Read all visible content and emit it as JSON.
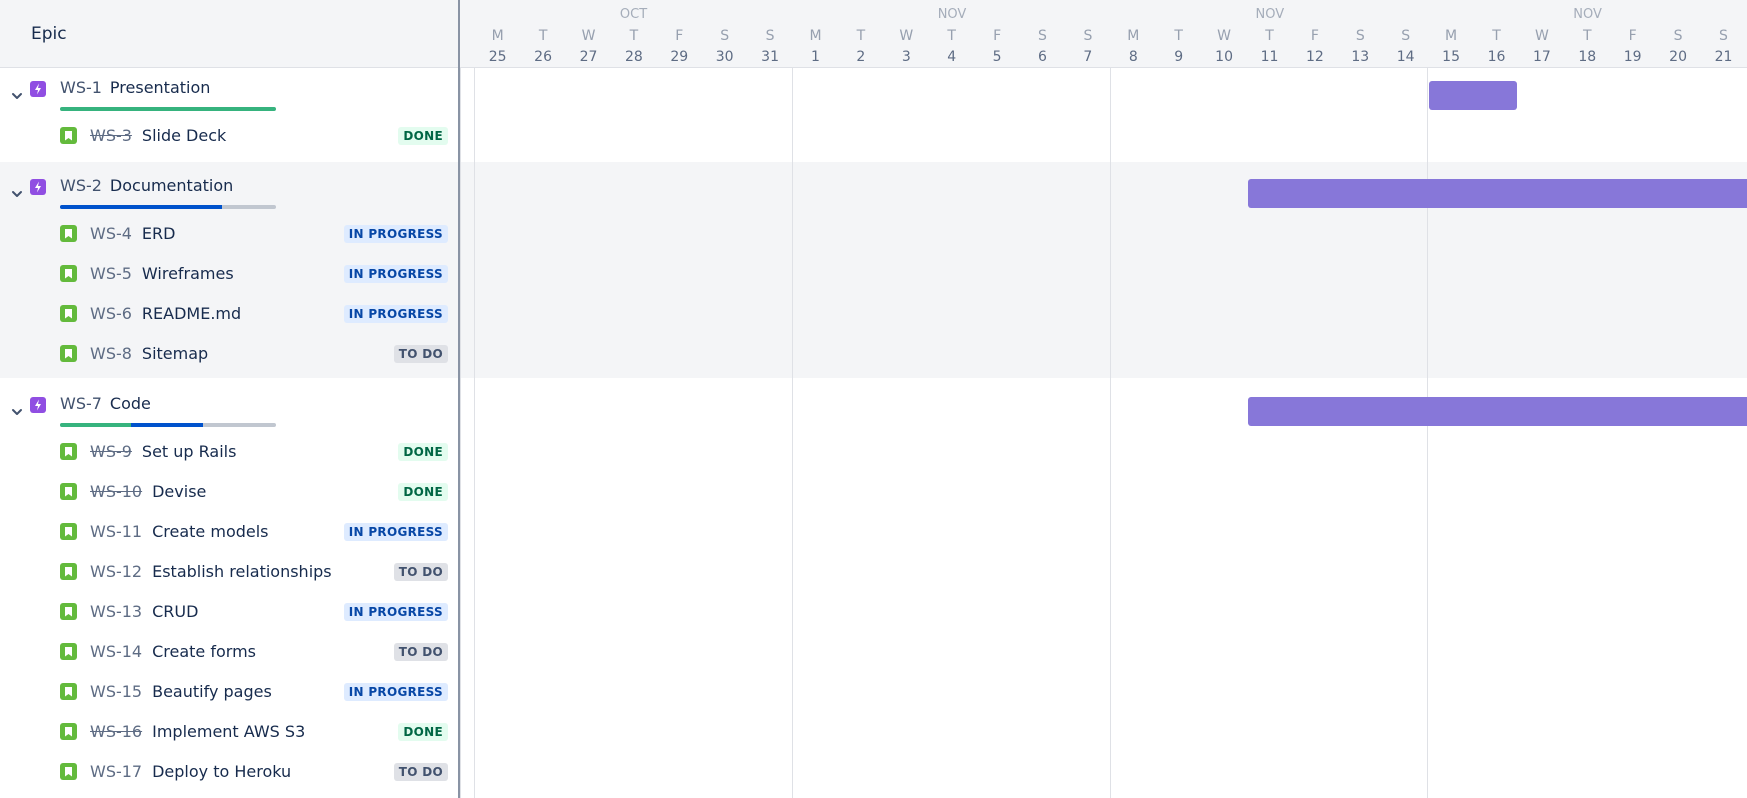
{
  "header": {
    "epic_column_title": "Epic"
  },
  "colors": {
    "epic_icon": "#904ee2",
    "story_icon": "#63ba3c",
    "bar": "#8777d9",
    "done": "#36b37e",
    "in_progress": "#0052cc",
    "remaining": "#c1c7d0"
  },
  "icons": {
    "collapse": "chevron-down-icon",
    "epic": "lightning-icon",
    "story": "bookmark-icon"
  },
  "epics": [
    {
      "key": "WS-1",
      "name": "Presentation",
      "progress": {
        "done": 1.0,
        "in_progress": 0.0
      },
      "issues": [
        {
          "key": "WS-3",
          "name": "Slide Deck",
          "status": "DONE"
        }
      ]
    },
    {
      "key": "WS-2",
      "name": "Documentation",
      "progress": {
        "done": 0.0,
        "in_progress": 0.75
      },
      "issues": [
        {
          "key": "WS-4",
          "name": "ERD",
          "status": "IN PROGRESS"
        },
        {
          "key": "WS-5",
          "name": "Wireframes",
          "status": "IN PROGRESS"
        },
        {
          "key": "WS-6",
          "name": "README.md",
          "status": "IN PROGRESS"
        },
        {
          "key": "WS-8",
          "name": "Sitemap",
          "status": "TO DO"
        }
      ]
    },
    {
      "key": "WS-7",
      "name": "Code",
      "progress": {
        "done": 0.33,
        "in_progress": 0.33
      },
      "issues": [
        {
          "key": "WS-9",
          "name": "Set up Rails",
          "status": "DONE"
        },
        {
          "key": "WS-10",
          "name": "Devise",
          "status": "DONE"
        },
        {
          "key": "WS-11",
          "name": "Create models",
          "status": "IN PROGRESS"
        },
        {
          "key": "WS-12",
          "name": "Establish relationships",
          "status": "TO DO"
        },
        {
          "key": "WS-13",
          "name": "CRUD",
          "status": "IN PROGRESS"
        },
        {
          "key": "WS-14",
          "name": "Create forms",
          "status": "TO DO"
        },
        {
          "key": "WS-15",
          "name": "Beautify pages",
          "status": "IN PROGRESS"
        },
        {
          "key": "WS-16",
          "name": "Implement AWS S3",
          "status": "DONE"
        },
        {
          "key": "WS-17",
          "name": "Deploy to Heroku",
          "status": "TO DO"
        }
      ]
    }
  ],
  "timeline": {
    "weeks": [
      {
        "month": "OCT",
        "days": [
          {
            "dow": "M",
            "date": "25"
          },
          {
            "dow": "T",
            "date": "26"
          },
          {
            "dow": "W",
            "date": "27"
          },
          {
            "dow": "T",
            "date": "28"
          },
          {
            "dow": "F",
            "date": "29"
          },
          {
            "dow": "S",
            "date": "30"
          },
          {
            "dow": "S",
            "date": "31"
          }
        ]
      },
      {
        "month": "NOV",
        "days": [
          {
            "dow": "M",
            "date": "1"
          },
          {
            "dow": "T",
            "date": "2"
          },
          {
            "dow": "W",
            "date": "3"
          },
          {
            "dow": "T",
            "date": "4"
          },
          {
            "dow": "F",
            "date": "5"
          },
          {
            "dow": "S",
            "date": "6"
          },
          {
            "dow": "S",
            "date": "7"
          }
        ]
      },
      {
        "month": "NOV",
        "days": [
          {
            "dow": "M",
            "date": "8"
          },
          {
            "dow": "T",
            "date": "9"
          },
          {
            "dow": "W",
            "date": "10"
          },
          {
            "dow": "T",
            "date": "11"
          },
          {
            "dow": "F",
            "date": "12"
          },
          {
            "dow": "S",
            "date": "13"
          },
          {
            "dow": "S",
            "date": "14"
          }
        ]
      },
      {
        "month": "NOV",
        "days": [
          {
            "dow": "M",
            "date": "15"
          },
          {
            "dow": "T",
            "date": "16"
          },
          {
            "dow": "W",
            "date": "17"
          },
          {
            "dow": "T",
            "date": "18"
          },
          {
            "dow": "F",
            "date": "19"
          },
          {
            "dow": "S",
            "date": "20"
          },
          {
            "dow": "S",
            "date": "21"
          }
        ]
      }
    ],
    "bars": [
      {
        "epic": "WS-1",
        "start": "Nov 15",
        "end": "Nov 16"
      },
      {
        "epic": "WS-2",
        "start": "Nov 11",
        "end": "beyond Nov 21"
      },
      {
        "epic": "WS-7",
        "start": "Nov 11",
        "end": "beyond Nov 21"
      }
    ]
  }
}
